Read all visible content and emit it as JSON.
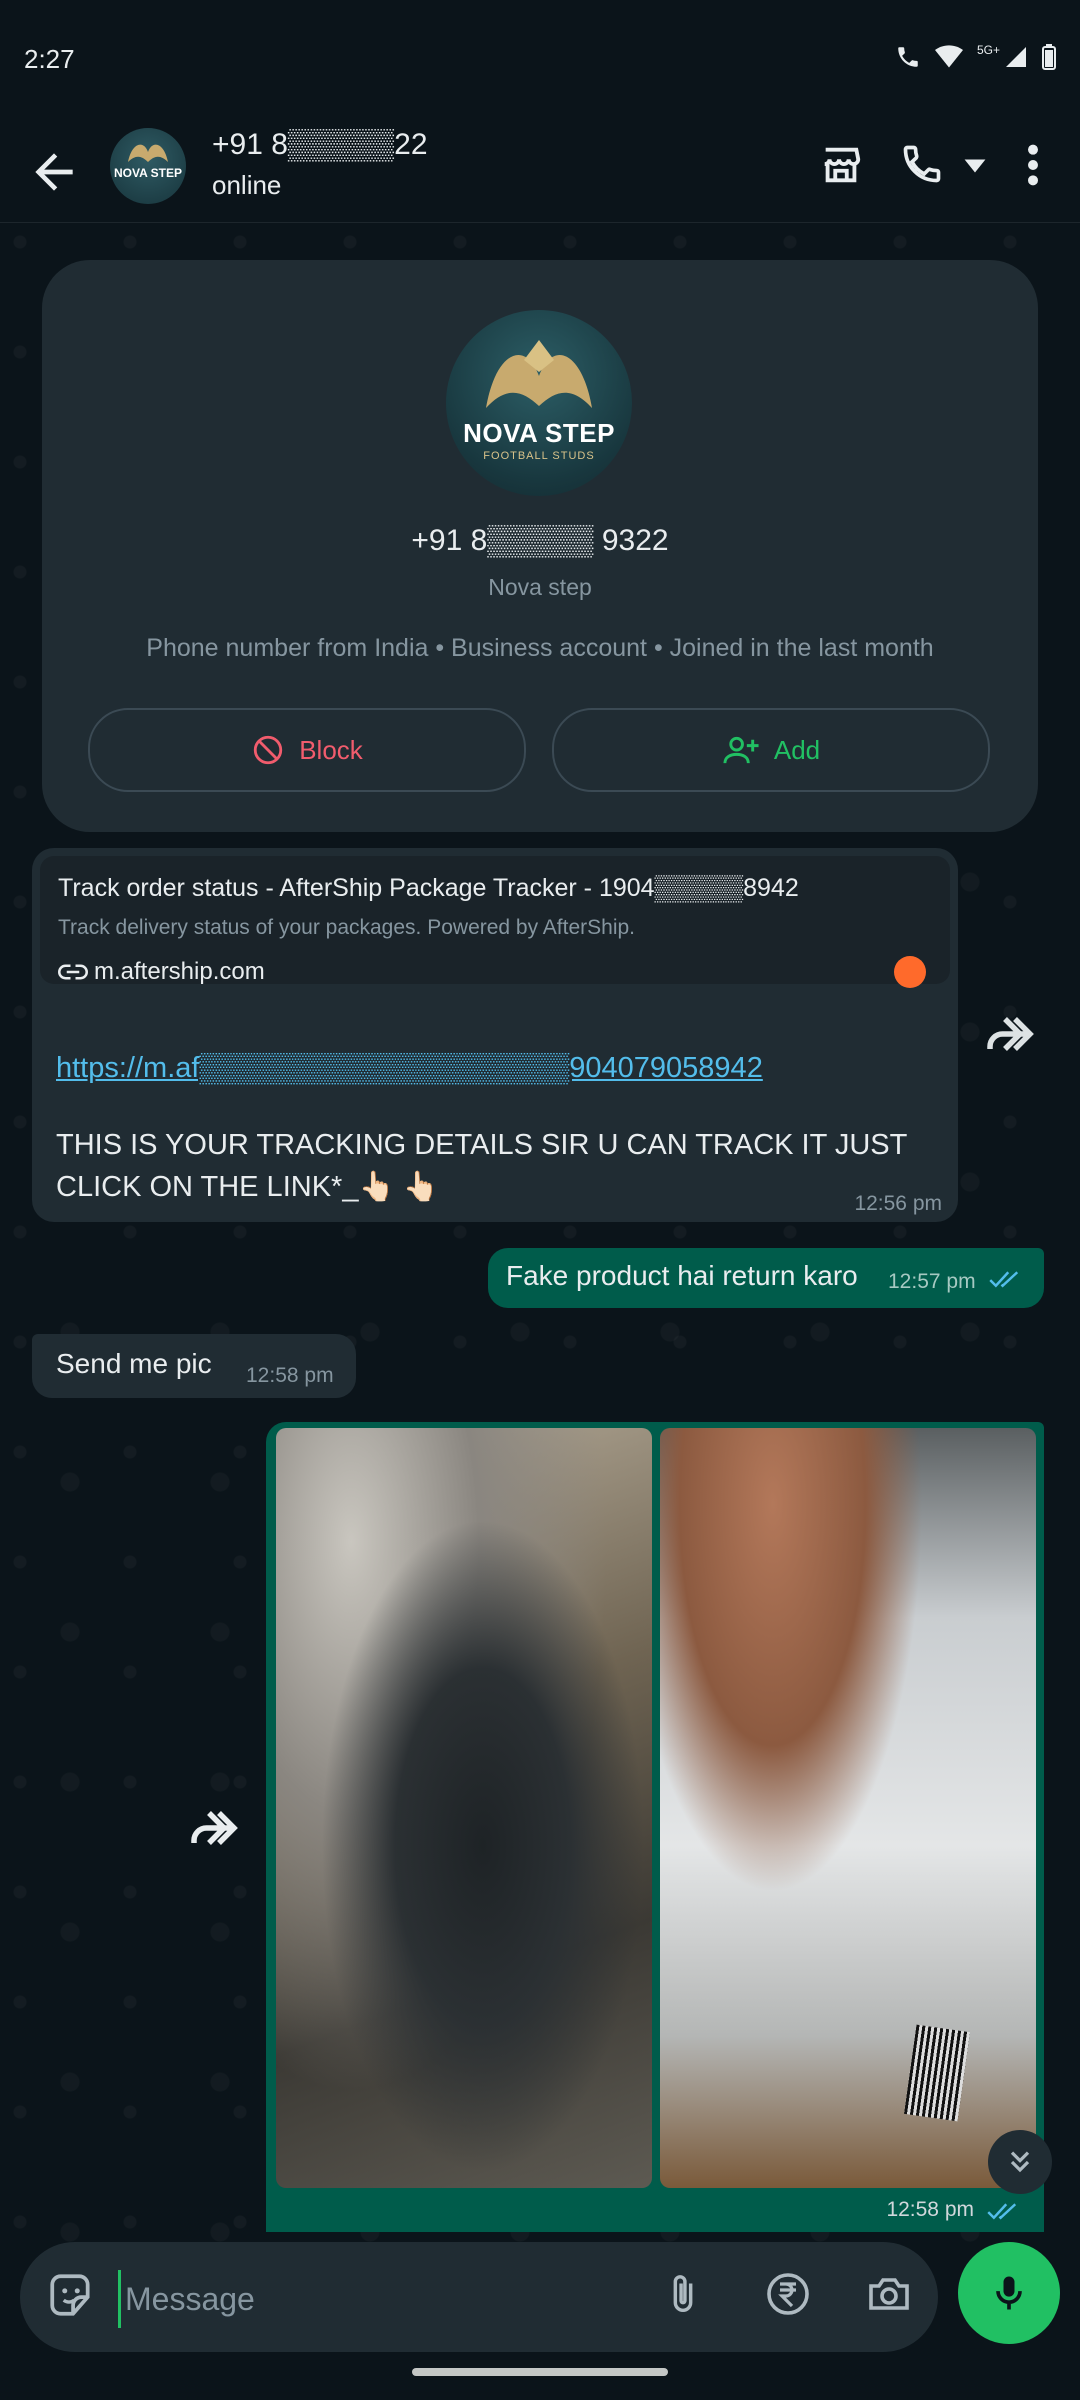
{
  "status_bar": {
    "time": "2:27",
    "network": "5G+"
  },
  "header": {
    "contact_name": "+91 8▒▒▒▒▒22",
    "status": "online",
    "avatar_text": "NOVA STEP",
    "icons": [
      "back-arrow-icon",
      "store-icon",
      "call-icon",
      "dropdown-icon",
      "more-vert-icon"
    ]
  },
  "profile_card": {
    "brand": "NOVA STEP",
    "brand_sub": "FOOTBALL STUDS",
    "phone": "+91 8▒▒▒▒▒ 9322",
    "name": "Nova step",
    "info": "Phone number from India • Business account • Joined in the last month",
    "block_label": "Block",
    "add_label": "Add"
  },
  "messages": [
    {
      "direction": "incoming",
      "preview_title": "Track order status - AfterShip Package Tracker - 1904▒▒▒▒▒8942",
      "preview_desc": "Track delivery status of your packages. Powered by AfterShip.",
      "preview_domain": "m.aftership.com",
      "url": "https://m.af▒▒▒▒▒▒▒▒▒▒▒▒▒▒▒▒▒▒904079058942",
      "body": "THIS IS YOUR TRACKING DETAILS SIR U CAN TRACK IT JUST CLICK ON THE LINK*_👆🏻 👆🏻",
      "time": "12:56 pm"
    },
    {
      "direction": "outgoing",
      "text": "Fake product hai return karo",
      "time": "12:57 pm",
      "read": true
    },
    {
      "direction": "incoming",
      "text": "Send me pic",
      "time": "12:58 pm"
    },
    {
      "direction": "outgoing",
      "type": "photos",
      "count": 2,
      "time": "12:58 pm",
      "read": true
    }
  ],
  "composer": {
    "placeholder": "Message"
  },
  "colors": {
    "background": "#0b141a",
    "incoming_bubble": "#202c33",
    "outgoing_bubble": "#005c4b",
    "accent_green": "#21c063",
    "block_red": "#f15c6d",
    "link_blue": "#53bdeb",
    "read_ticks": "#53bdeb"
  }
}
